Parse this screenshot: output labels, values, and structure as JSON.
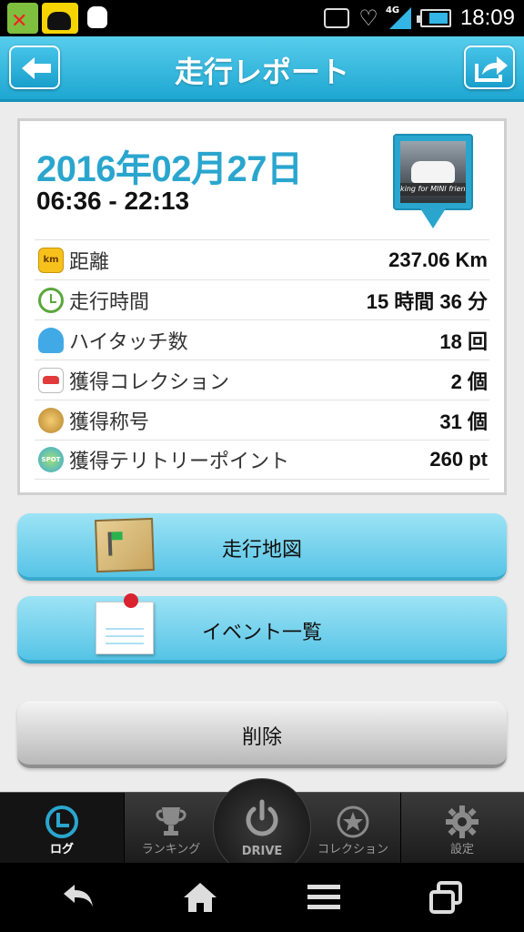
{
  "status_bar": {
    "time": "18:09",
    "network": "4G",
    "notification_icons": [
      "android-error-icon",
      "cat-icon",
      "dog-icon"
    ],
    "status_icons": [
      "qr-icon",
      "heart-icon",
      "signal-icon",
      "battery-icon"
    ]
  },
  "header": {
    "title": "走行レポート",
    "back_icon": "back-arrow-icon",
    "share_icon": "share-icon"
  },
  "report": {
    "date": "2016年02月27日",
    "time_range": "06:36 - 22:13",
    "photo_caption": "king for MINI frien",
    "stats": [
      {
        "icon": "km",
        "label": "距離",
        "value": "237.06 Km"
      },
      {
        "icon": "clock",
        "label": "走行時間",
        "value": "15 時間 36 分"
      },
      {
        "icon": "hand",
        "label": "ハイタッチ数",
        "value": "18 回"
      },
      {
        "icon": "car",
        "label": "獲得コレクション",
        "value": "2 個"
      },
      {
        "icon": "title-medal",
        "label": "獲得称号",
        "value": "31 個"
      },
      {
        "icon": "spot",
        "label": "獲得テリトリーポイント",
        "value": "260 pt"
      }
    ]
  },
  "actions": {
    "map_label": "走行地図",
    "event_label": "イベント一覧",
    "delete_label": "削除"
  },
  "tabs": [
    {
      "label": "ログ",
      "icon": "clock-icon",
      "active": true
    },
    {
      "label": "ランキング",
      "icon": "trophy-icon"
    },
    {
      "label": "DRIVE",
      "icon": "power-icon"
    },
    {
      "label": "コレクション",
      "icon": "star-icon"
    },
    {
      "label": "設定",
      "icon": "gear-icon"
    }
  ],
  "colors": {
    "accent": "#2aa6ce",
    "header": "#1ea7d2",
    "button": "#56c4e6"
  }
}
